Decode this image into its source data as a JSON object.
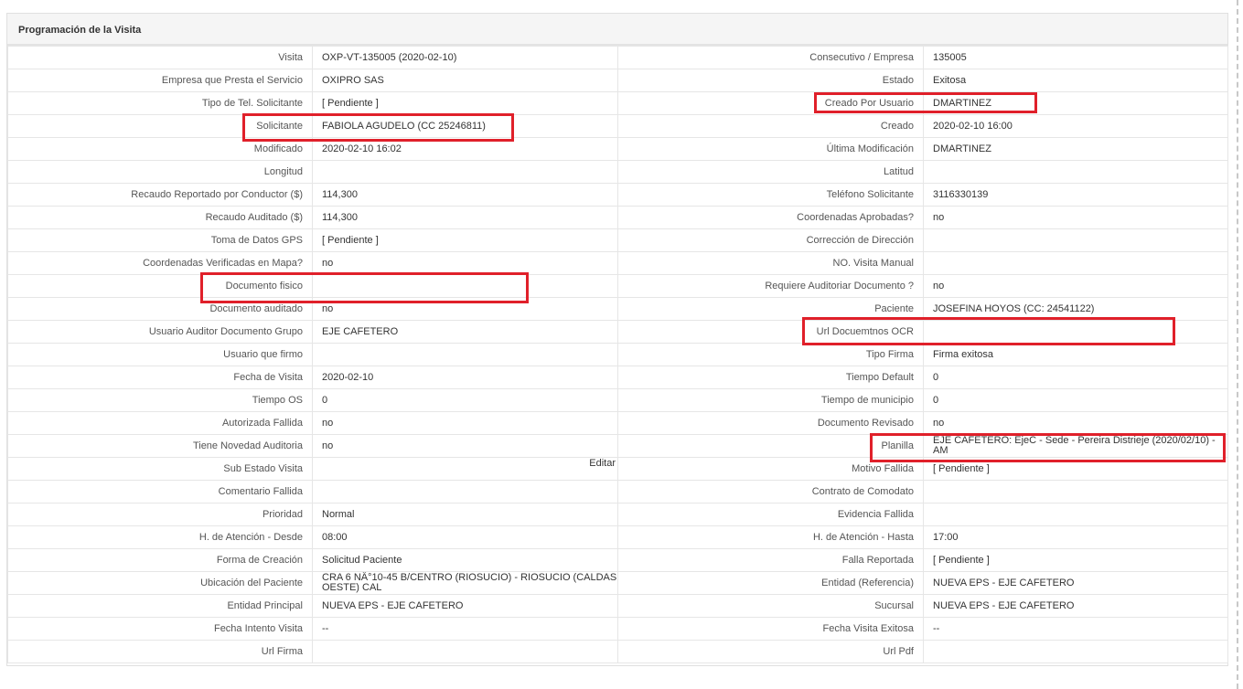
{
  "panel": {
    "title": "Programación de la Visita",
    "edit_label": "Editar"
  },
  "rows": [
    {
      "l1": "Visita",
      "v1": "OXP-VT-135005 (2020-02-10)",
      "l2": "Consecutivo / Empresa",
      "v2": "135005"
    },
    {
      "l1": "Empresa que Presta el Servicio",
      "v1": "OXIPRO SAS",
      "l2": "Estado",
      "v2": "Exitosa"
    },
    {
      "l1": "Tipo de Tel. Solicitante",
      "v1": "[ Pendiente ]",
      "l2": "Creado Por Usuario",
      "v2": "DMARTINEZ"
    },
    {
      "l1": "Solicitante",
      "v1": "FABIOLA AGUDELO (CC 25246811)",
      "l2": "Creado",
      "v2": "2020-02-10 16:00"
    },
    {
      "l1": "Modificado",
      "v1": "2020-02-10 16:02",
      "l2": "Última Modificación",
      "v2": " DMARTINEZ"
    },
    {
      "l1": "Longitud",
      "v1": "",
      "l2": "Latitud",
      "v2": ""
    },
    {
      "l1": "Recaudo Reportado por Conductor ($)",
      "v1": "114,300",
      "l2": "Teléfono Solicitante",
      "v2": "3116330139"
    },
    {
      "l1": "Recaudo Auditado ($)",
      "v1": "114,300",
      "l2": "Coordenadas Aprobadas?",
      "v2": " no"
    },
    {
      "l1": "Toma de Datos GPS",
      "v1": "[ Pendiente ]",
      "l2": "Corrección de Dirección",
      "v2": ""
    },
    {
      "l1": "Coordenadas Verificadas en Mapa?",
      "v1": " no",
      "l2": "NO. Visita Manual",
      "v2": ""
    },
    {
      "l1": "Documento fisico",
      "v1": "",
      "l2": "Requiere Auditoriar Documento ?",
      "v2": " no"
    },
    {
      "l1": "Documento auditado",
      "v1": " no",
      "l2": "Paciente",
      "v2": "JOSEFINA HOYOS (CC: 24541122)"
    },
    {
      "l1": "Usuario Auditor Documento Grupo",
      "v1": "EJE CAFETERO",
      "l2": "Url Docuemtnos OCR",
      "v2": ""
    },
    {
      "l1": "Usuario que firmo",
      "v1": "",
      "l2": "Tipo Firma",
      "v2": "Firma exitosa"
    },
    {
      "l1": "Fecha de Visita",
      "v1": " 2020-02-10",
      "l2": "Tiempo Default",
      "v2": "0"
    },
    {
      "l1": "Tiempo OS",
      "v1": "0",
      "l2": "Tiempo de municipio",
      "v2": "0"
    },
    {
      "l1": "Autorizada Fallida",
      "v1": " no",
      "l2": "Documento Revisado",
      "v2": " no"
    },
    {
      "l1": "Tiene Novedad Auditoria",
      "v1": " no",
      "l2": "Planilla",
      "v2": "EJE CAFETERO: EjeC - Sede - Pereira Distrieje (2020/02/10) - AM"
    },
    {
      "l1": "Sub Estado Visita",
      "v1": "",
      "l2": "Motivo Fallida",
      "v2": "[ Pendiente ]"
    },
    {
      "l1": "Comentario Fallida",
      "v1": "",
      "l2": "Contrato de Comodato",
      "v2": ""
    },
    {
      "l1": "Prioridad",
      "v1": "Normal",
      "l2": "Evidencia Fallida",
      "v2": ""
    },
    {
      "l1": "H. de Atención - Desde",
      "v1": "08:00",
      "l2": "H. de Atención - Hasta",
      "v2": "17:00"
    },
    {
      "l1": "Forma de Creación",
      "v1": "Solicitud Paciente",
      "l2": "Falla Reportada",
      "v2": "[ Pendiente ]"
    },
    {
      "l1": "Ubicación del Paciente",
      "v1": "CRA 6 NÂ°10-45 B/CENTRO (RIOSUCIO) - RIOSUCIO (CALDAS OESTE) CAL",
      "l2": "Entidad (Referencia)",
      "v2": "NUEVA EPS - EJE CAFETERO"
    },
    {
      "l1": "Entidad Principal",
      "v1": "NUEVA EPS - EJE CAFETERO",
      "l2": "Sucursal",
      "v2": "NUEVA EPS - EJE CAFETERO"
    },
    {
      "l1": "Fecha Intento Visita",
      "v1": " --",
      "l2": "Fecha Visita Exitosa",
      "v2": " --"
    },
    {
      "l1": "Url Firma",
      "v1": "",
      "l2": "Url Pdf",
      "v2": ""
    }
  ],
  "highlight_color": "#e0202a"
}
